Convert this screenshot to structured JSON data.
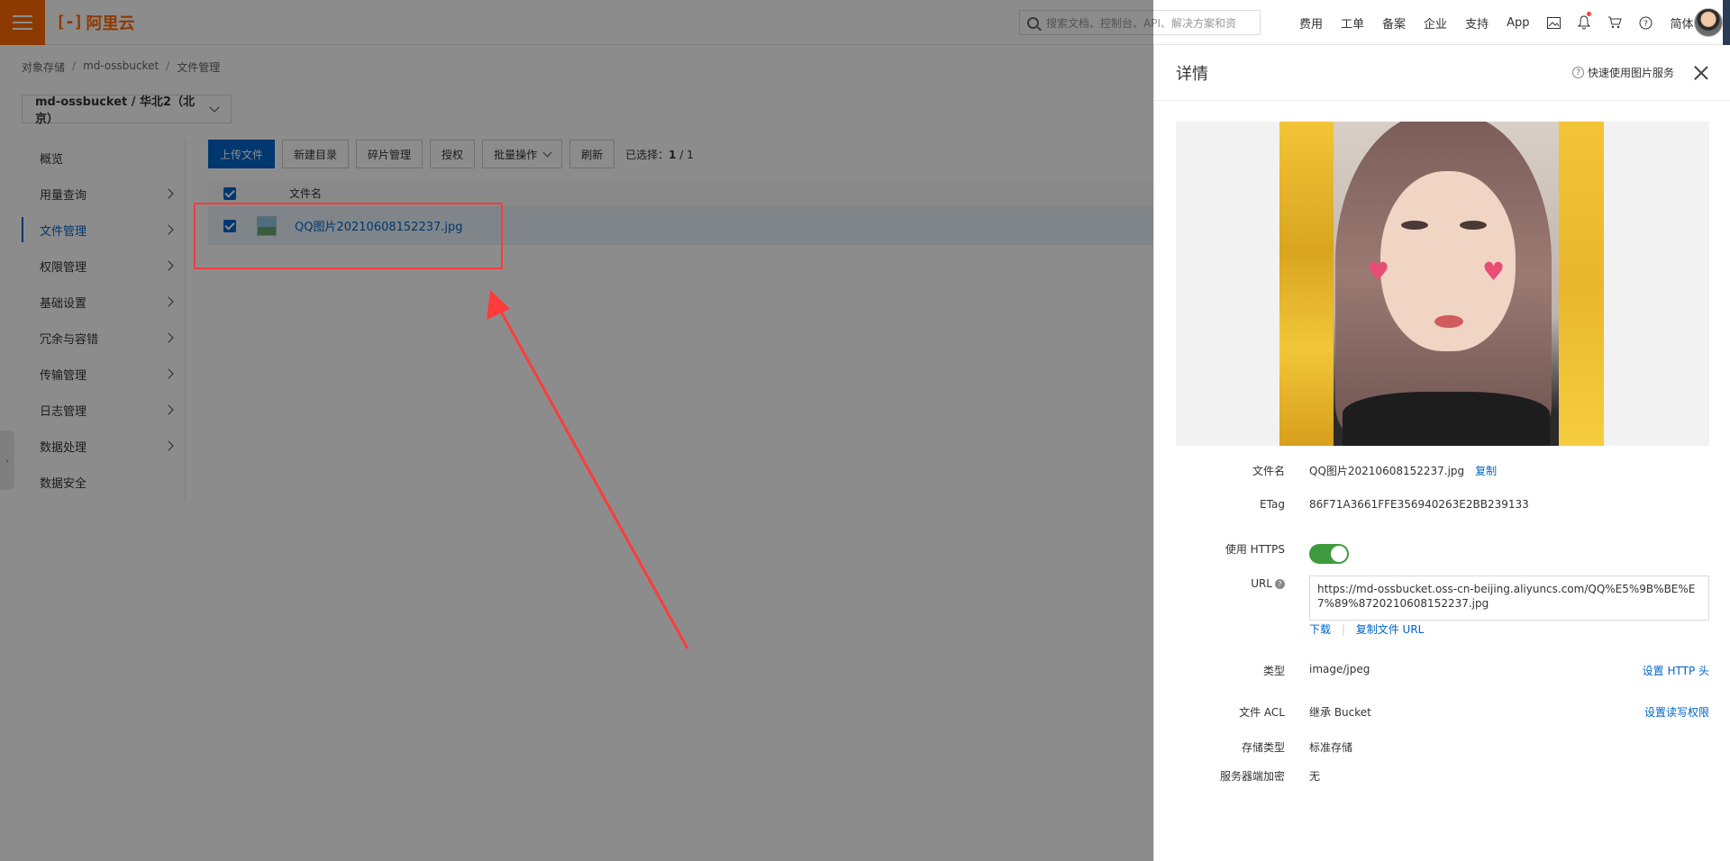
{
  "header": {
    "logo_text": "阿里云",
    "logo_mark": "[-]",
    "search_placeholder": "搜索文档、控制台、API、解决方案和资",
    "nav": [
      "费用",
      "工单",
      "备案",
      "企业",
      "支持",
      "App"
    ],
    "lang": "简体"
  },
  "breadcrumb": [
    "对象存储",
    "md-ossbucket",
    "文件管理"
  ],
  "bucket_selector": "md-ossbucket / 华北2（北京）",
  "sidebar": {
    "items": [
      {
        "label": "概览",
        "has_arrow": false
      },
      {
        "label": "用量查询",
        "has_arrow": true
      },
      {
        "label": "文件管理",
        "has_arrow": true,
        "active": true
      },
      {
        "label": "权限管理",
        "has_arrow": true
      },
      {
        "label": "基础设置",
        "has_arrow": true
      },
      {
        "label": "冗余与容错",
        "has_arrow": true
      },
      {
        "label": "传输管理",
        "has_arrow": true
      },
      {
        "label": "日志管理",
        "has_arrow": true
      },
      {
        "label": "数据处理",
        "has_arrow": true
      },
      {
        "label": "数据安全",
        "has_arrow": false
      }
    ]
  },
  "toolbar": {
    "upload": "上传文件",
    "new_dir": "新建目录",
    "fragments": "碎片管理",
    "authorize": "授权",
    "batch": "批量操作",
    "refresh": "刷新",
    "selected_label": "已选择：",
    "selected_count": "1",
    "selected_total": " / 1"
  },
  "table": {
    "header_name": "文件名",
    "rows": [
      {
        "name": "QQ图片20210608152237.jpg",
        "checked": true
      }
    ]
  },
  "drawer": {
    "title": "详情",
    "help_link": "快速使用图片服务",
    "fields": {
      "filename_label": "文件名",
      "filename": "QQ图片20210608152237.jpg",
      "copy": "复制",
      "etag_label": "ETag",
      "etag": "86F71A3661FFE356940263E2BB239133",
      "https_label": "使用 HTTPS",
      "https_enabled": true,
      "url_label": "URL",
      "url": "https://md-ossbucket.oss-cn-beijing.aliyuncs.com/QQ%E5%9B%BE%E7%89%8720210608152237.jpg",
      "download": "下载",
      "copy_url": "复制文件 URL",
      "type_label": "类型",
      "type": "image/jpeg",
      "set_http_header": "设置 HTTP 头",
      "acl_label": "文件 ACL",
      "acl": "继承 Bucket",
      "set_acl": "设置读写权限",
      "storage_label": "存储类型",
      "storage": "标准存储",
      "encryption_label": "服务器端加密",
      "encryption": "无"
    }
  },
  "colors": {
    "accent": "#0064c8",
    "brand": "#ff6a00",
    "annotation": "#ff3b3b",
    "toggle_on": "#3d9b3d"
  }
}
